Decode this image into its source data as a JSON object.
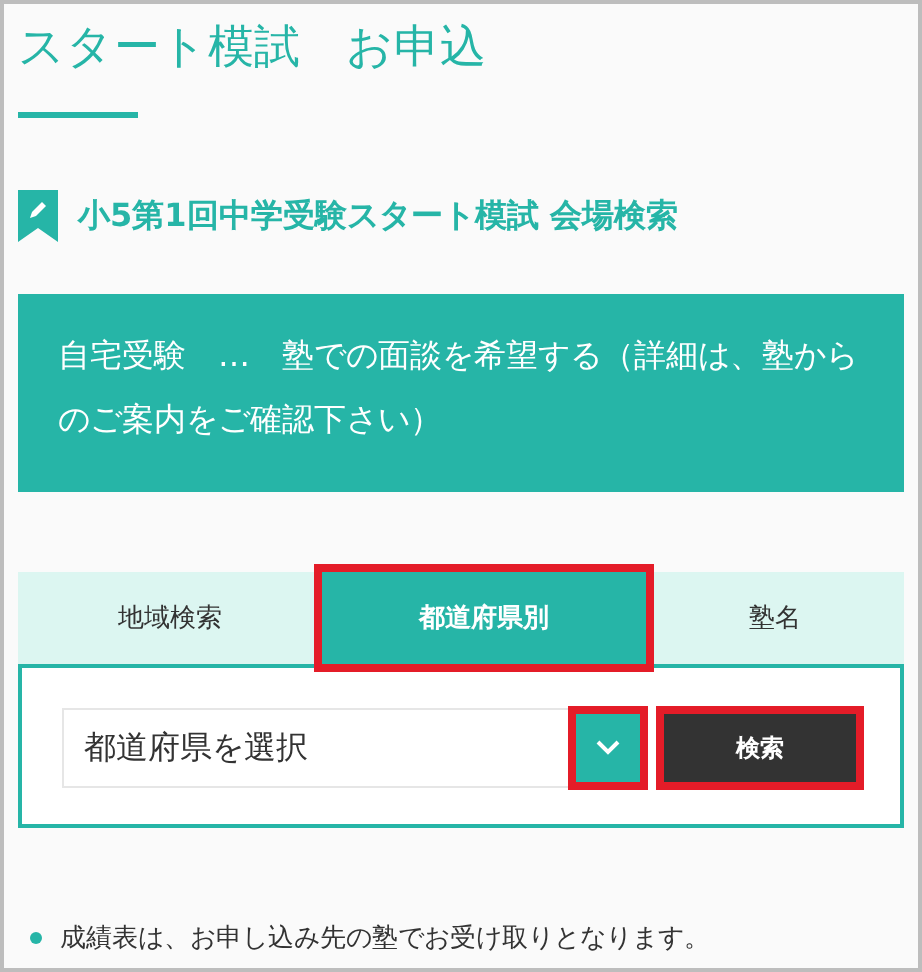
{
  "page": {
    "title": "スタート模試　お申込"
  },
  "section": {
    "heading": "小5第1回中学受験スタート模試 会場検索"
  },
  "notice": {
    "text": "自宅受験　…　塾での面談を希望する（詳細は、塾からのご案内をご確認下さい）"
  },
  "tabs": [
    {
      "label": "地域検索",
      "selected": false,
      "highlighted": false
    },
    {
      "label": "都道府県別",
      "selected": true,
      "highlighted": true
    },
    {
      "label": "塾名",
      "selected": false,
      "highlighted": false
    }
  ],
  "search": {
    "select": {
      "value": "都道府県を選択"
    },
    "dropdown_highlighted": true,
    "button": {
      "label": "検索",
      "highlighted": true
    }
  },
  "notes": [
    "成績表は、お申し込み先の塾でお受け取りとなります。"
  ]
}
